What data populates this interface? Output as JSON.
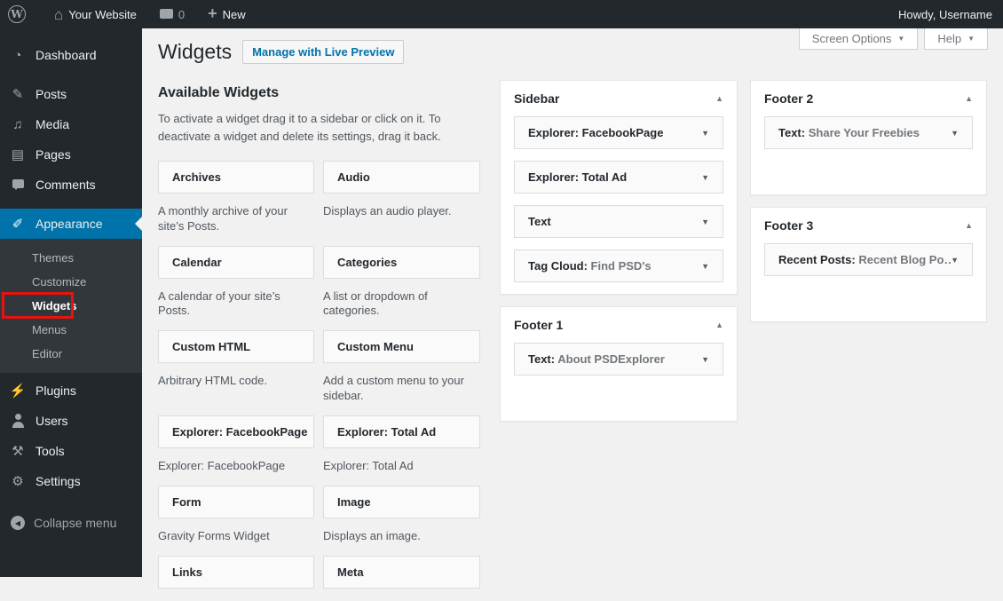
{
  "colors": {
    "admin_bar_bg": "#23282d",
    "menu_bg": "#23282d",
    "submenu_bg": "#32373c",
    "active_item_bg": "#0073aa",
    "link_blue": "#0073aa",
    "content_bg": "#f1f1f1",
    "annotation_red": "#e8120e"
  },
  "admin_bar": {
    "logo": "wordpress-logo",
    "site_name": "Your Website",
    "comments_count": "0",
    "new_label": "New",
    "howdy": "Howdy, Username"
  },
  "menu": {
    "items": [
      {
        "label": "Dashboard",
        "icon": "dashboard-icon",
        "active": false,
        "sep_after": true
      },
      {
        "label": "Posts",
        "icon": "posts-icon",
        "active": false
      },
      {
        "label": "Media",
        "icon": "media-icon",
        "active": false
      },
      {
        "label": "Pages",
        "icon": "pages-icon",
        "active": false
      },
      {
        "label": "Comments",
        "icon": "comments-icon",
        "active": false,
        "sep_after": true
      },
      {
        "label": "Appearance",
        "icon": "appearance-icon",
        "active": true
      }
    ],
    "appearance_submenu": [
      {
        "label": "Themes",
        "current": false
      },
      {
        "label": "Customize",
        "current": false
      },
      {
        "label": "Widgets",
        "current": true
      },
      {
        "label": "Menus",
        "current": false
      },
      {
        "label": "Editor",
        "current": false
      }
    ],
    "items_after": [
      {
        "label": "Plugins",
        "icon": "plugins-icon",
        "active": false
      },
      {
        "label": "Users",
        "icon": "users-icon",
        "active": false
      },
      {
        "label": "Tools",
        "icon": "tools-icon",
        "active": false
      },
      {
        "label": "Settings",
        "icon": "settings-icon",
        "active": false,
        "sep_after": true
      }
    ],
    "collapse_label": "Collapse menu"
  },
  "screen_meta": {
    "screen_options_label": "Screen Options",
    "help_label": "Help"
  },
  "page": {
    "title": "Widgets",
    "action_button": "Manage with Live Preview"
  },
  "available": {
    "heading": "Available Widgets",
    "description": "To activate a widget drag it to a sidebar or click on it. To deactivate a widget and delete its settings, drag it back.",
    "widgets": [
      {
        "name": "Archives",
        "description": "A monthly archive of your site’s Posts."
      },
      {
        "name": "Audio",
        "description": "Displays an audio player."
      },
      {
        "name": "Calendar",
        "description": "A calendar of your site’s Posts."
      },
      {
        "name": "Categories",
        "description": "A list or dropdown of categories."
      },
      {
        "name": "Custom HTML",
        "description": "Arbitrary HTML code."
      },
      {
        "name": "Custom Menu",
        "description": "Add a custom menu to your sidebar."
      },
      {
        "name": "Explorer: FacebookPage",
        "description": "Explorer: FacebookPage"
      },
      {
        "name": "Explorer: Total Ad",
        "description": "Explorer: Total Ad"
      },
      {
        "name": "Form",
        "description": "Gravity Forms Widget"
      },
      {
        "name": "Image",
        "description": "Displays an image."
      },
      {
        "name": "Links",
        "description": ""
      },
      {
        "name": "Meta",
        "description": ""
      }
    ]
  },
  "areas": {
    "sidebar": {
      "title": "Sidebar",
      "widgets": [
        {
          "title": "Explorer: FacebookPage",
          "subtitle": ""
        },
        {
          "title": "Explorer: Total Ad",
          "subtitle": ""
        },
        {
          "title": "Text",
          "subtitle": ""
        },
        {
          "title": "Tag Cloud:",
          "subtitle": "Find PSD's"
        }
      ]
    },
    "footer1": {
      "title": "Footer 1",
      "widgets": [
        {
          "title": "Text:",
          "subtitle": "About PSDExplorer"
        }
      ]
    },
    "footer2": {
      "title": "Footer 2",
      "widgets": [
        {
          "title": "Text:",
          "subtitle": "Share Your Freebies"
        }
      ]
    },
    "footer3": {
      "title": "Footer 3",
      "widgets": [
        {
          "title": "Recent Posts:",
          "subtitle": "Recent Blog Po…"
        }
      ]
    }
  }
}
